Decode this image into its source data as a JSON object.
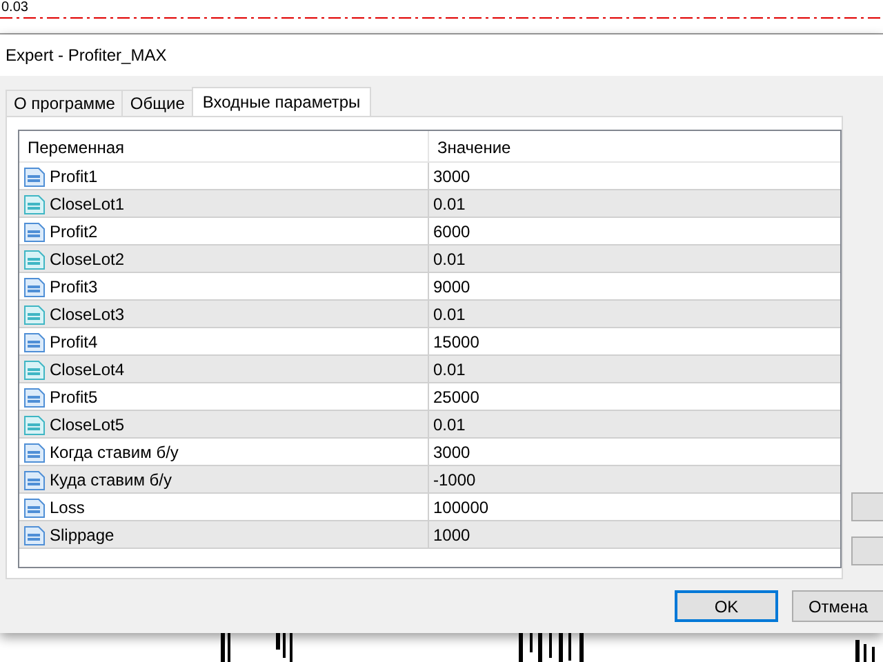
{
  "chart": {
    "price_label": "0.03"
  },
  "window": {
    "title": "Expert - Profiter_MAX"
  },
  "tabs": [
    {
      "label": "О программе",
      "selected": false
    },
    {
      "label": "Общие",
      "selected": false
    },
    {
      "label": "Входные параметры",
      "selected": true
    }
  ],
  "table": {
    "columns": [
      "Переменная",
      "Значение"
    ],
    "rows": [
      {
        "kind": "int",
        "name": "Profit1",
        "value": "3000"
      },
      {
        "kind": "double",
        "name": "CloseLot1",
        "value": "0.01"
      },
      {
        "kind": "int",
        "name": "Profit2",
        "value": "6000"
      },
      {
        "kind": "double",
        "name": "CloseLot2",
        "value": "0.01"
      },
      {
        "kind": "int",
        "name": "Profit3",
        "value": "9000"
      },
      {
        "kind": "double",
        "name": "CloseLot3",
        "value": "0.01"
      },
      {
        "kind": "int",
        "name": "Profit4",
        "value": "15000"
      },
      {
        "kind": "double",
        "name": "CloseLot4",
        "value": "0.01"
      },
      {
        "kind": "int",
        "name": "Profit5",
        "value": "25000"
      },
      {
        "kind": "double",
        "name": "CloseLot5",
        "value": "0.01"
      },
      {
        "kind": "int",
        "name": "Когда ставим б/у",
        "value": "3000"
      },
      {
        "kind": "int",
        "name": "Куда ставим б/у",
        "value": "-1000"
      },
      {
        "kind": "int",
        "name": "Loss",
        "value": "100000"
      },
      {
        "kind": "int",
        "name": "Slippage",
        "value": "1000"
      }
    ]
  },
  "buttons": [
    {
      "label": "OK",
      "default": true
    },
    {
      "label": "Отмена",
      "default": false
    }
  ]
}
